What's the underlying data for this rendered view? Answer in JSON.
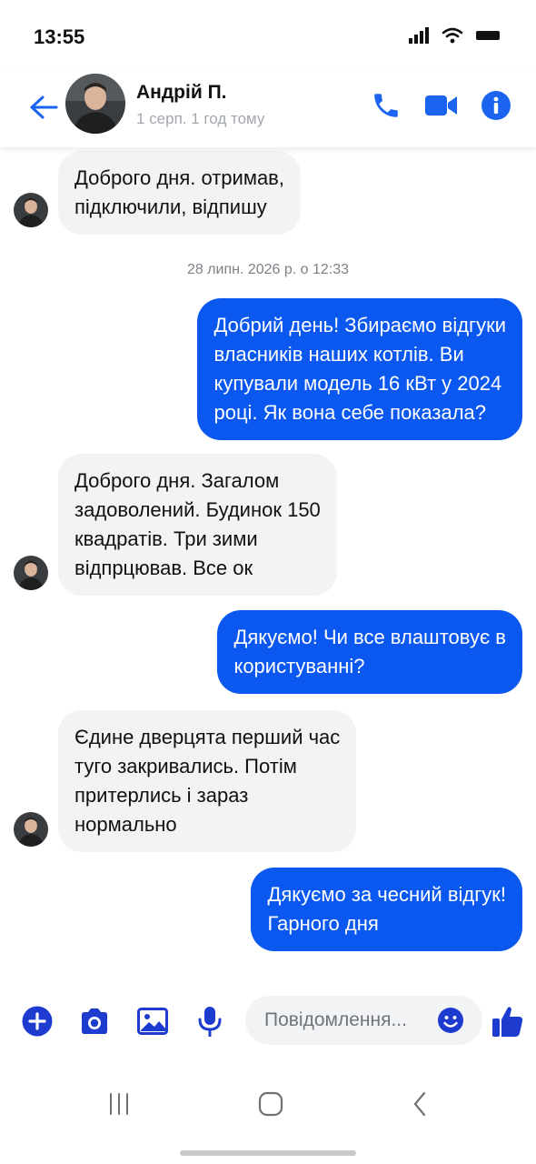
{
  "status_bar": {
    "time": "13:55"
  },
  "header": {
    "contact_name": "Андрій П.",
    "contact_status": "1 серп. 1 год тому"
  },
  "messages": [
    {
      "direction": "in",
      "lines": [
        "Доброго дня. отримав,",
        "підключили, відпишу"
      ]
    },
    {
      "direction": "separator",
      "text": "28 липн. 2026 р. о 12:33"
    },
    {
      "direction": "out",
      "lines": [
        "Добрий день! Збираємо відгуки",
        "власників наших котлів. Ви",
        "купували модель 16 кВт у 2024",
        "році. Як вона себе показала?"
      ]
    },
    {
      "direction": "in",
      "lines": [
        "Доброго дня. Загалом",
        "задоволений. Будинок 150",
        "квадратів. Три зими",
        "відпрцював. Все ок"
      ]
    },
    {
      "direction": "out",
      "lines": [
        "Дякуємо! Чи все влаштовує в",
        "користуванні?"
      ]
    },
    {
      "direction": "in",
      "lines": [
        "Єдине дверцята перший час",
        "туго закривались. Потім",
        "притерлись і зараз",
        "нормально"
      ]
    },
    {
      "direction": "out",
      "lines": [
        "Дякуємо за чесний відгук!",
        "Гарного дня"
      ]
    }
  ],
  "composer": {
    "placeholder": "Повідомлення..."
  },
  "icons": {
    "back": "arrow-left-icon",
    "call": "phone-icon",
    "video": "video-camera-icon",
    "info": "info-icon",
    "add": "plus-icon",
    "camera": "camera-icon",
    "gallery": "image-icon",
    "mic": "microphone-icon",
    "emoji": "emoji-icon",
    "like": "thumbs-up-icon"
  },
  "colors": {
    "accent": "#0a58f0",
    "outgoing_bubble": "#0a58f0",
    "incoming_bubble": "#f2f3f5",
    "muted_text": "#a2a6ad"
  }
}
